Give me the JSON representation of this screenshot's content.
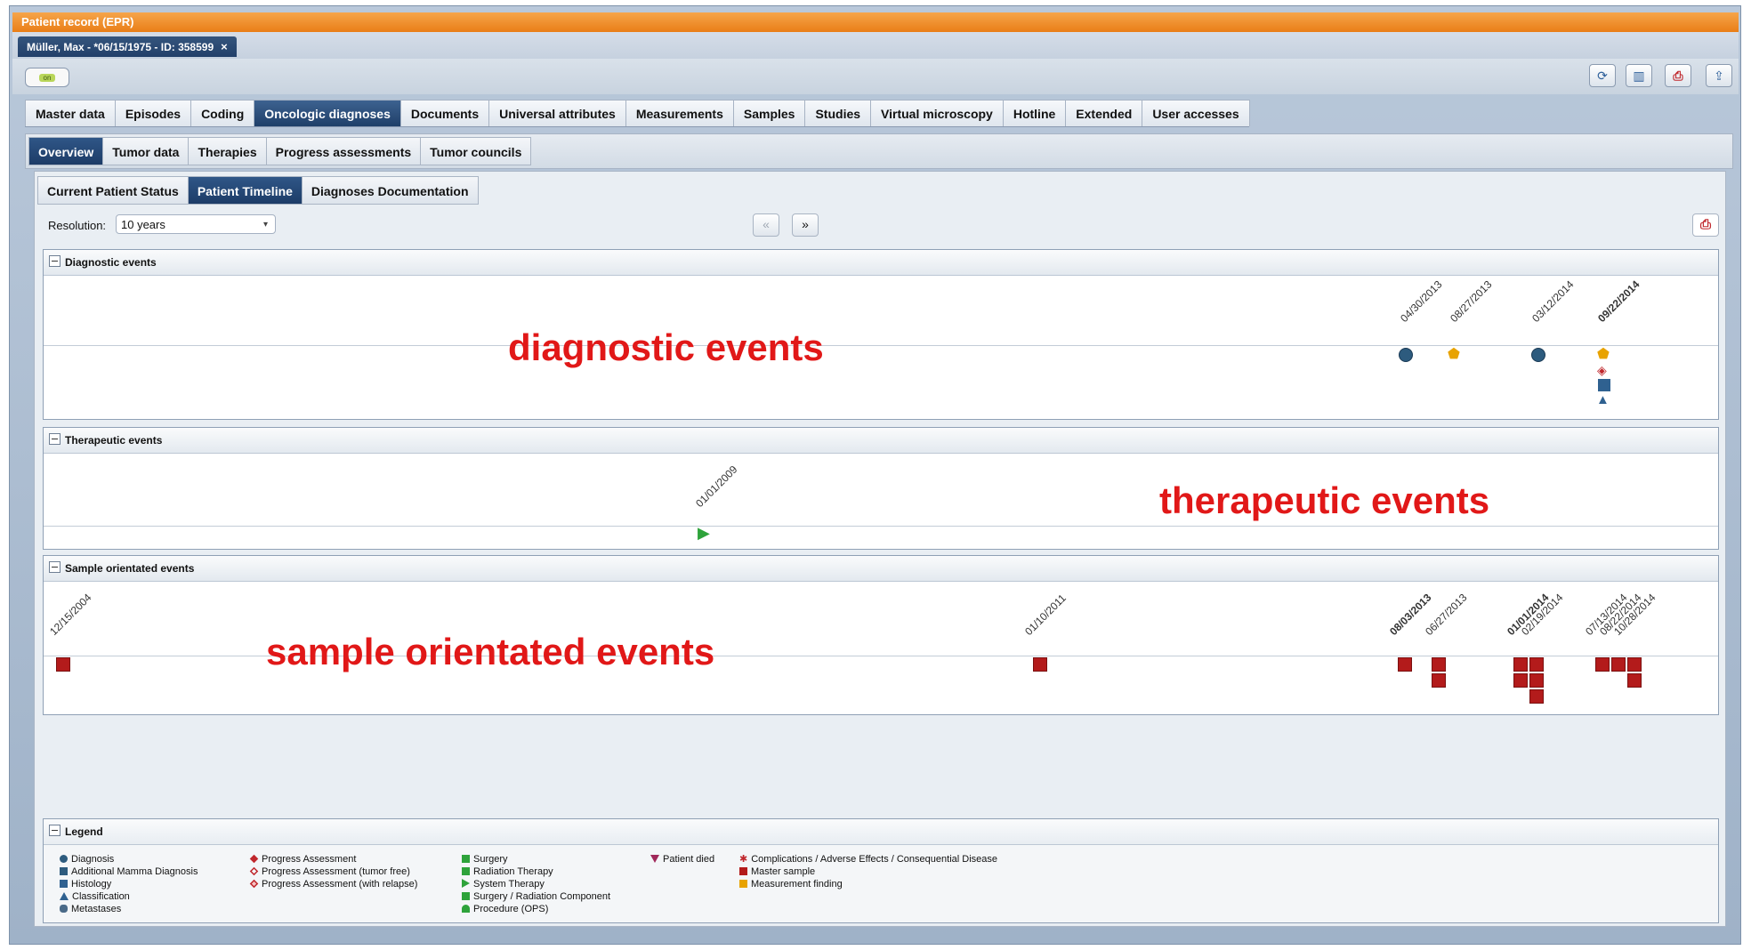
{
  "window_title": "Patient record (EPR)",
  "patient_tab": "Müller, Max - *06/15/1975 - ID: 358599",
  "patient_tab_close": "×",
  "status_badge": "on",
  "main_tabs": [
    "Master data",
    "Episodes",
    "Coding",
    "Oncologic diagnoses",
    "Documents",
    "Universal attributes",
    "Measurements",
    "Samples",
    "Studies",
    "Virtual microscopy",
    "Hotline",
    "Extended",
    "User accesses"
  ],
  "sub_tabs": [
    "Overview",
    "Tumor data",
    "Therapies",
    "Progress assessments",
    "Tumor councils"
  ],
  "overview_tabs": [
    "Current Patient Status",
    "Patient Timeline",
    "Diagnoses Documentation"
  ],
  "resolution": {
    "label": "Resolution:",
    "value": "10 years"
  },
  "nav": {
    "prev": "«",
    "next": "»"
  },
  "panels": {
    "diagnostic": {
      "title": "Diagnostic events",
      "overlay": "diagnostic events",
      "dates": [
        "04/30/2013",
        "08/27/2013",
        "03/12/2014",
        "09/22/2014"
      ]
    },
    "therapeutic": {
      "title": "Therapeutic events",
      "overlay": "therapeutic events",
      "dates": [
        "01/01/2009"
      ]
    },
    "sample": {
      "title": "Sample orientated events",
      "overlay": "sample orientated events",
      "dates": [
        "12/15/2004",
        "01/10/2011",
        "08/03/2013",
        "06/27/2013",
        "01/01/2014",
        "02/19/2014",
        "07/13/2014",
        "08/22/2014",
        "10/28/2014"
      ]
    }
  },
  "legend": {
    "title": "Legend",
    "col1": [
      "Diagnosis",
      "Additional Mamma Diagnosis",
      "Histology",
      "Classification",
      "Metastases"
    ],
    "col2": [
      "Progress Assessment",
      "Progress Assessment (tumor free)",
      "Progress Assessment (with relapse)"
    ],
    "col3": [
      "Surgery",
      "Radiation Therapy",
      "System Therapy",
      "Surgery / Radiation Component",
      "Procedure (OPS)"
    ],
    "col4": [
      "Patient died"
    ],
    "col5": [
      "Complications / Adverse Effects / Consequential Disease",
      "Master sample",
      "Measurement finding"
    ]
  },
  "colors": {
    "accent_orange": "#e97e17",
    "active_tab": "#1f3f69",
    "event_red": "#b31b1b",
    "overlay_red": "#e11818"
  }
}
